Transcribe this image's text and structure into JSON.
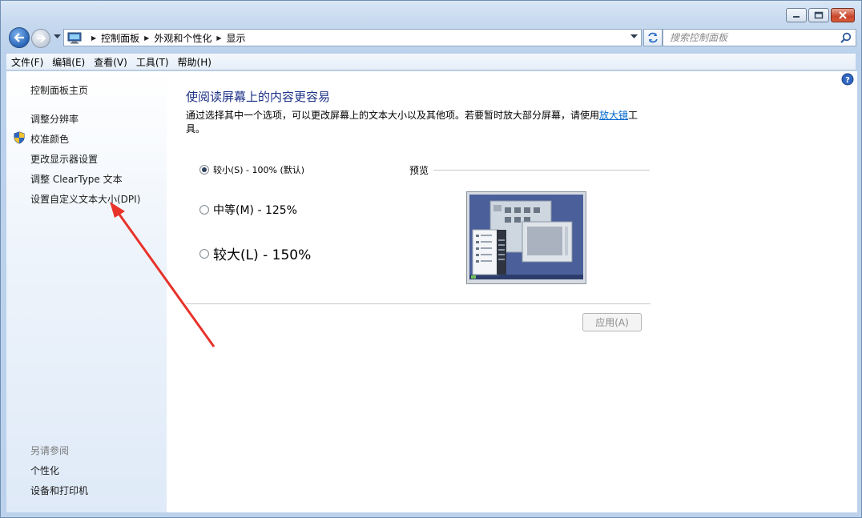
{
  "window": {
    "controls": [
      "minimize",
      "maximize",
      "close"
    ]
  },
  "address": {
    "breadcrumbs": [
      "控制面板",
      "外观和个性化",
      "显示"
    ],
    "icon": "computer-icon"
  },
  "search": {
    "placeholder": "搜索控制面板"
  },
  "menu": {
    "items": [
      "文件(F)",
      "编辑(E)",
      "查看(V)",
      "工具(T)",
      "帮助(H)"
    ]
  },
  "sidebar": {
    "items": [
      {
        "label": "控制面板主页"
      },
      {
        "label": "调整分辨率"
      },
      {
        "label": "校准颜色",
        "icon": "shield-icon"
      },
      {
        "label": "更改显示器设置"
      },
      {
        "label": "调整 ClearType 文本"
      },
      {
        "label": "设置自定义文本大小(DPI)"
      }
    ],
    "see_also_title": "另请参阅",
    "see_also": [
      {
        "label": "个性化"
      },
      {
        "label": "设备和打印机"
      }
    ]
  },
  "main": {
    "heading": "使阅读屏幕上的内容更容易",
    "description_before": "通过选择其中一个选项，可以更改屏幕上的文本大小以及其他项。若要暂时放大部分屏幕，请使用",
    "description_link": "放大镜",
    "description_after": "工具。",
    "options": [
      {
        "label": "较小(S) - 100% (默认)",
        "selected": true
      },
      {
        "label": "中等(M) - 125%",
        "selected": false
      },
      {
        "label": "较大(L) - 150%",
        "selected": false
      }
    ],
    "preview_label": "预览",
    "apply_label": "应用(A)",
    "apply_enabled": false
  },
  "colors": {
    "heading": "#1e3287",
    "link": "#0066cc",
    "annotation_arrow": "#e8332a"
  }
}
